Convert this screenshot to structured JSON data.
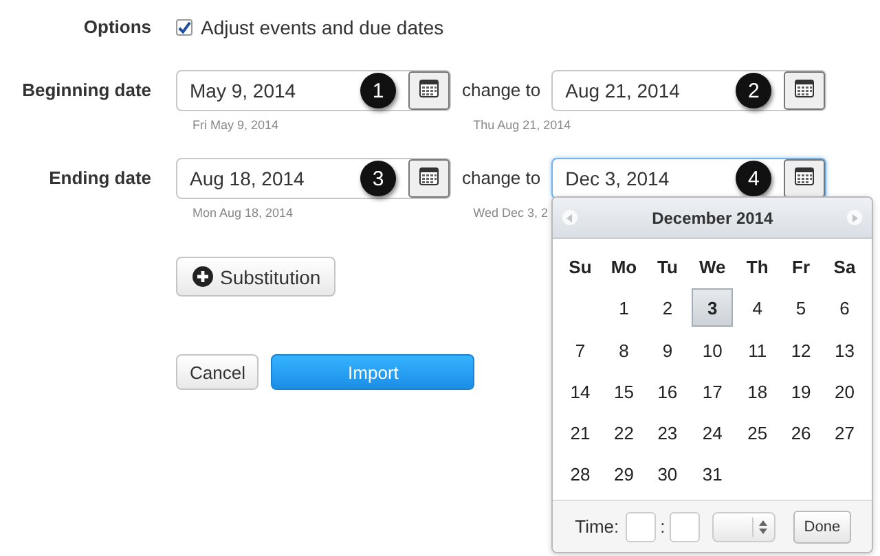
{
  "options": {
    "label": "Options",
    "checkbox": {
      "label": "Adjust events and due dates",
      "checked": true
    }
  },
  "date_rows": [
    {
      "label": "Beginning date",
      "from": {
        "value": "May 9, 2014",
        "hint": "Fri May 9, 2014",
        "callout": "1",
        "focused": false
      },
      "change_to": "change to",
      "to": {
        "value": "Aug 21, 2014",
        "hint": "Thu Aug 21, 2014",
        "callout": "2",
        "focused": false
      }
    },
    {
      "label": "Ending date",
      "from": {
        "value": "Aug 18, 2014",
        "hint": "Mon Aug 18, 2014",
        "callout": "3",
        "focused": false
      },
      "change_to": "change to",
      "to": {
        "value": "Dec 3, 2014",
        "hint": "Wed Dec 3, 2",
        "callout": "4",
        "focused": true
      }
    }
  ],
  "substitution_button": "Substitution",
  "buttons": [
    {
      "label": "Cancel",
      "kind": "default"
    },
    {
      "label": "Import",
      "kind": "primary"
    }
  ],
  "calendar": {
    "title": "December 2014",
    "weekdays": [
      "Su",
      "Mo",
      "Tu",
      "We",
      "Th",
      "Fr",
      "Sa"
    ],
    "weeks": [
      [
        {
          "day": "1",
          "selected": false
        },
        {
          "day": "2",
          "selected": false
        },
        {
          "day": "3",
          "selected": true
        },
        {
          "day": "4",
          "selected": false
        },
        {
          "day": "5",
          "selected": false
        },
        {
          "day": "6",
          "selected": false
        }
      ],
      [
        {
          "day": "7",
          "selected": false
        },
        {
          "day": "8",
          "selected": false
        },
        {
          "day": "9",
          "selected": false
        },
        {
          "day": "10",
          "selected": false
        },
        {
          "day": "11",
          "selected": false
        },
        {
          "day": "12",
          "selected": false
        },
        {
          "day": "13",
          "selected": false
        }
      ],
      [
        {
          "day": "14",
          "selected": false
        },
        {
          "day": "15",
          "selected": false
        },
        {
          "day": "16",
          "selected": false
        },
        {
          "day": "17",
          "selected": false
        },
        {
          "day": "18",
          "selected": false
        },
        {
          "day": "19",
          "selected": false
        },
        {
          "day": "20",
          "selected": false
        }
      ],
      [
        {
          "day": "21",
          "selected": false
        },
        {
          "day": "22",
          "selected": false
        },
        {
          "day": "23",
          "selected": false
        },
        {
          "day": "24",
          "selected": false
        },
        {
          "day": "25",
          "selected": false
        },
        {
          "day": "26",
          "selected": false
        },
        {
          "day": "27",
          "selected": false
        }
      ],
      [
        {
          "day": "28",
          "selected": false
        },
        {
          "day": "29",
          "selected": false
        },
        {
          "day": "30",
          "selected": false
        },
        {
          "day": "31",
          "selected": false
        }
      ]
    ],
    "time_label": "Time:",
    "time_separator": ":",
    "done": "Done"
  }
}
